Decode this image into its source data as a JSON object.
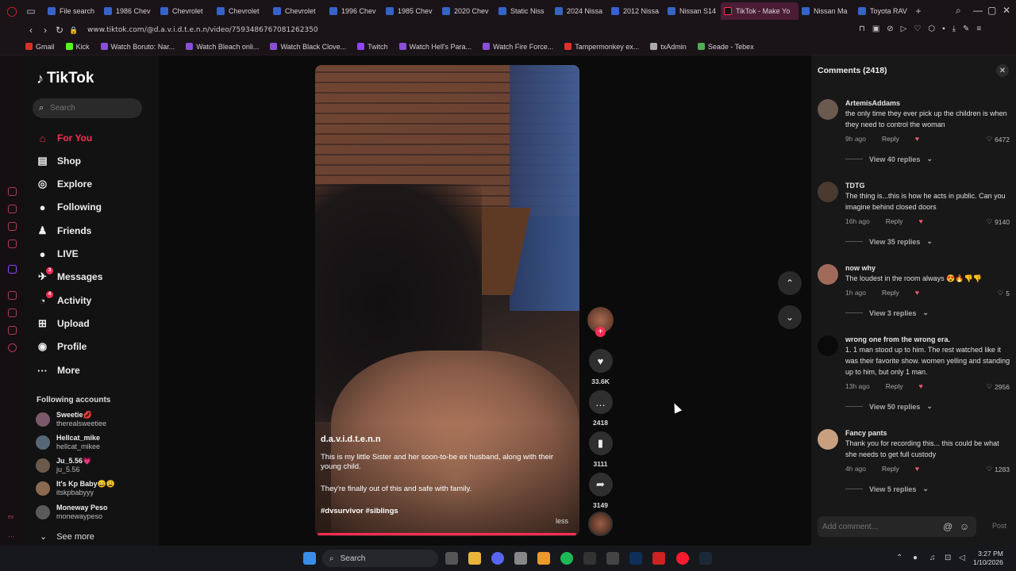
{
  "browser": {
    "tabs": [
      {
        "label": "File search"
      },
      {
        "label": "1986 Chev"
      },
      {
        "label": "Chevrolet"
      },
      {
        "label": "Chevrolet"
      },
      {
        "label": "Chevrolet"
      },
      {
        "label": "1996 Chev"
      },
      {
        "label": "1985 Chev"
      },
      {
        "label": "2020 Chev"
      },
      {
        "label": "Static Niss"
      },
      {
        "label": "2024 Nissa"
      },
      {
        "label": "2012 Nissa"
      },
      {
        "label": "Nissan S14"
      },
      {
        "label": "TikTok - Make Yo"
      },
      {
        "label": "Nissan Ma"
      },
      {
        "label": "Toyota RAV"
      }
    ],
    "url": "www.tiktok.com/@d.a.v.i.d.t.e.n.n/video/7593486767081262350",
    "bookmarks": [
      {
        "label": "Gmail",
        "color": "#d93025"
      },
      {
        "label": "Kick",
        "color": "#53fc18"
      },
      {
        "label": "Watch Boruto: Nar...",
        "color": "#8a4fd6"
      },
      {
        "label": "Watch Bleach onli...",
        "color": "#8a4fd6"
      },
      {
        "label": "Watch Black Clove...",
        "color": "#8a4fd6"
      },
      {
        "label": "Twitch",
        "color": "#9146ff"
      },
      {
        "label": "Watch Hell's Para...",
        "color": "#8a4fd6"
      },
      {
        "label": "Watch Fire Force...",
        "color": "#8a4fd6"
      },
      {
        "label": "Tampermonkey ex...",
        "color": "#e03030"
      },
      {
        "label": "txAdmin",
        "color": "#aaaaaa"
      },
      {
        "label": "Seade - Tebex",
        "color": "#4caf50"
      }
    ]
  },
  "tiktok": {
    "logo": "TikTok",
    "search_placeholder": "Search",
    "nav": [
      {
        "label": "For You",
        "icon": "home-icon"
      },
      {
        "label": "Shop",
        "icon": "bag-icon"
      },
      {
        "label": "Explore",
        "icon": "compass-icon"
      },
      {
        "label": "Following",
        "icon": "following-icon"
      },
      {
        "label": "Friends",
        "icon": "friends-icon"
      },
      {
        "label": "LIVE",
        "icon": "live-icon"
      },
      {
        "label": "Messages",
        "icon": "messages-icon",
        "badge": "3"
      },
      {
        "label": "Activity",
        "icon": "activity-icon",
        "badge": "4"
      },
      {
        "label": "Upload",
        "icon": "upload-icon"
      },
      {
        "label": "Profile",
        "icon": "profile-icon"
      },
      {
        "label": "More",
        "icon": "more-icon"
      }
    ],
    "following_title": "Following accounts",
    "following": [
      {
        "name": "Sweetie💋",
        "handle": "therealsweetiee"
      },
      {
        "name": "Hellcat_mike",
        "handle": "hellcat_mikee"
      },
      {
        "name": "Ju_5.56💗",
        "handle": "ju_5.56"
      },
      {
        "name": "It's Kp Baby😄😩",
        "handle": "itskpbabyyy"
      },
      {
        "name": "Moneway Peso",
        "handle": "monewaypeso"
      }
    ],
    "see_more": "See more"
  },
  "video": {
    "author": "d.a.v.i.d.t.e.n.n",
    "desc_line1": "This is my little Sister and her soon-to-be ex husband, along with their young child.",
    "desc_line2": "They're finally out of this and safe with family.",
    "tags": "#dvsurvivor #siblings",
    "less": "less",
    "likes": "33.6K",
    "comments": "2418",
    "saves": "3111",
    "shares": "3149"
  },
  "comments": {
    "title": "Comments (2418)",
    "items": [
      {
        "user": "ArtemisAddams",
        "text": "the only time they ever pick up the children is when they need to control the woman",
        "time": "9h ago",
        "likes": "6472",
        "view": "View 40 replies"
      },
      {
        "user": "TDTG",
        "text": "The thing is...this is how he acts in public. Can you imagine behind closed doors",
        "time": "16h ago",
        "likes": "9140",
        "view": "View 35 replies"
      },
      {
        "user": "now why",
        "text": "The loudest in the room always 😍🔥👎👎",
        "time": "1h ago",
        "likes": "5",
        "view": "View 3 replies"
      },
      {
        "user": "wrong one from the wrong era.",
        "text": "1. 1 man stood up to him. The rest watched like it was their favorite show. women yelling and standing up to him, but only 1 man.",
        "time": "13h ago",
        "likes": "2956",
        "view": "View 50 replies"
      },
      {
        "user": "Fancy pants",
        "text": "Thank you for recording this... this could be what she needs to get full custody",
        "time": "4h ago",
        "likes": "1283",
        "view": "View 5 replies"
      }
    ],
    "reply_label": "Reply",
    "input_placeholder": "Add comment...",
    "post_label": "Post"
  },
  "taskbar": {
    "search_label": "Search",
    "time": "3:27 PM",
    "date": "1/10/2026"
  }
}
